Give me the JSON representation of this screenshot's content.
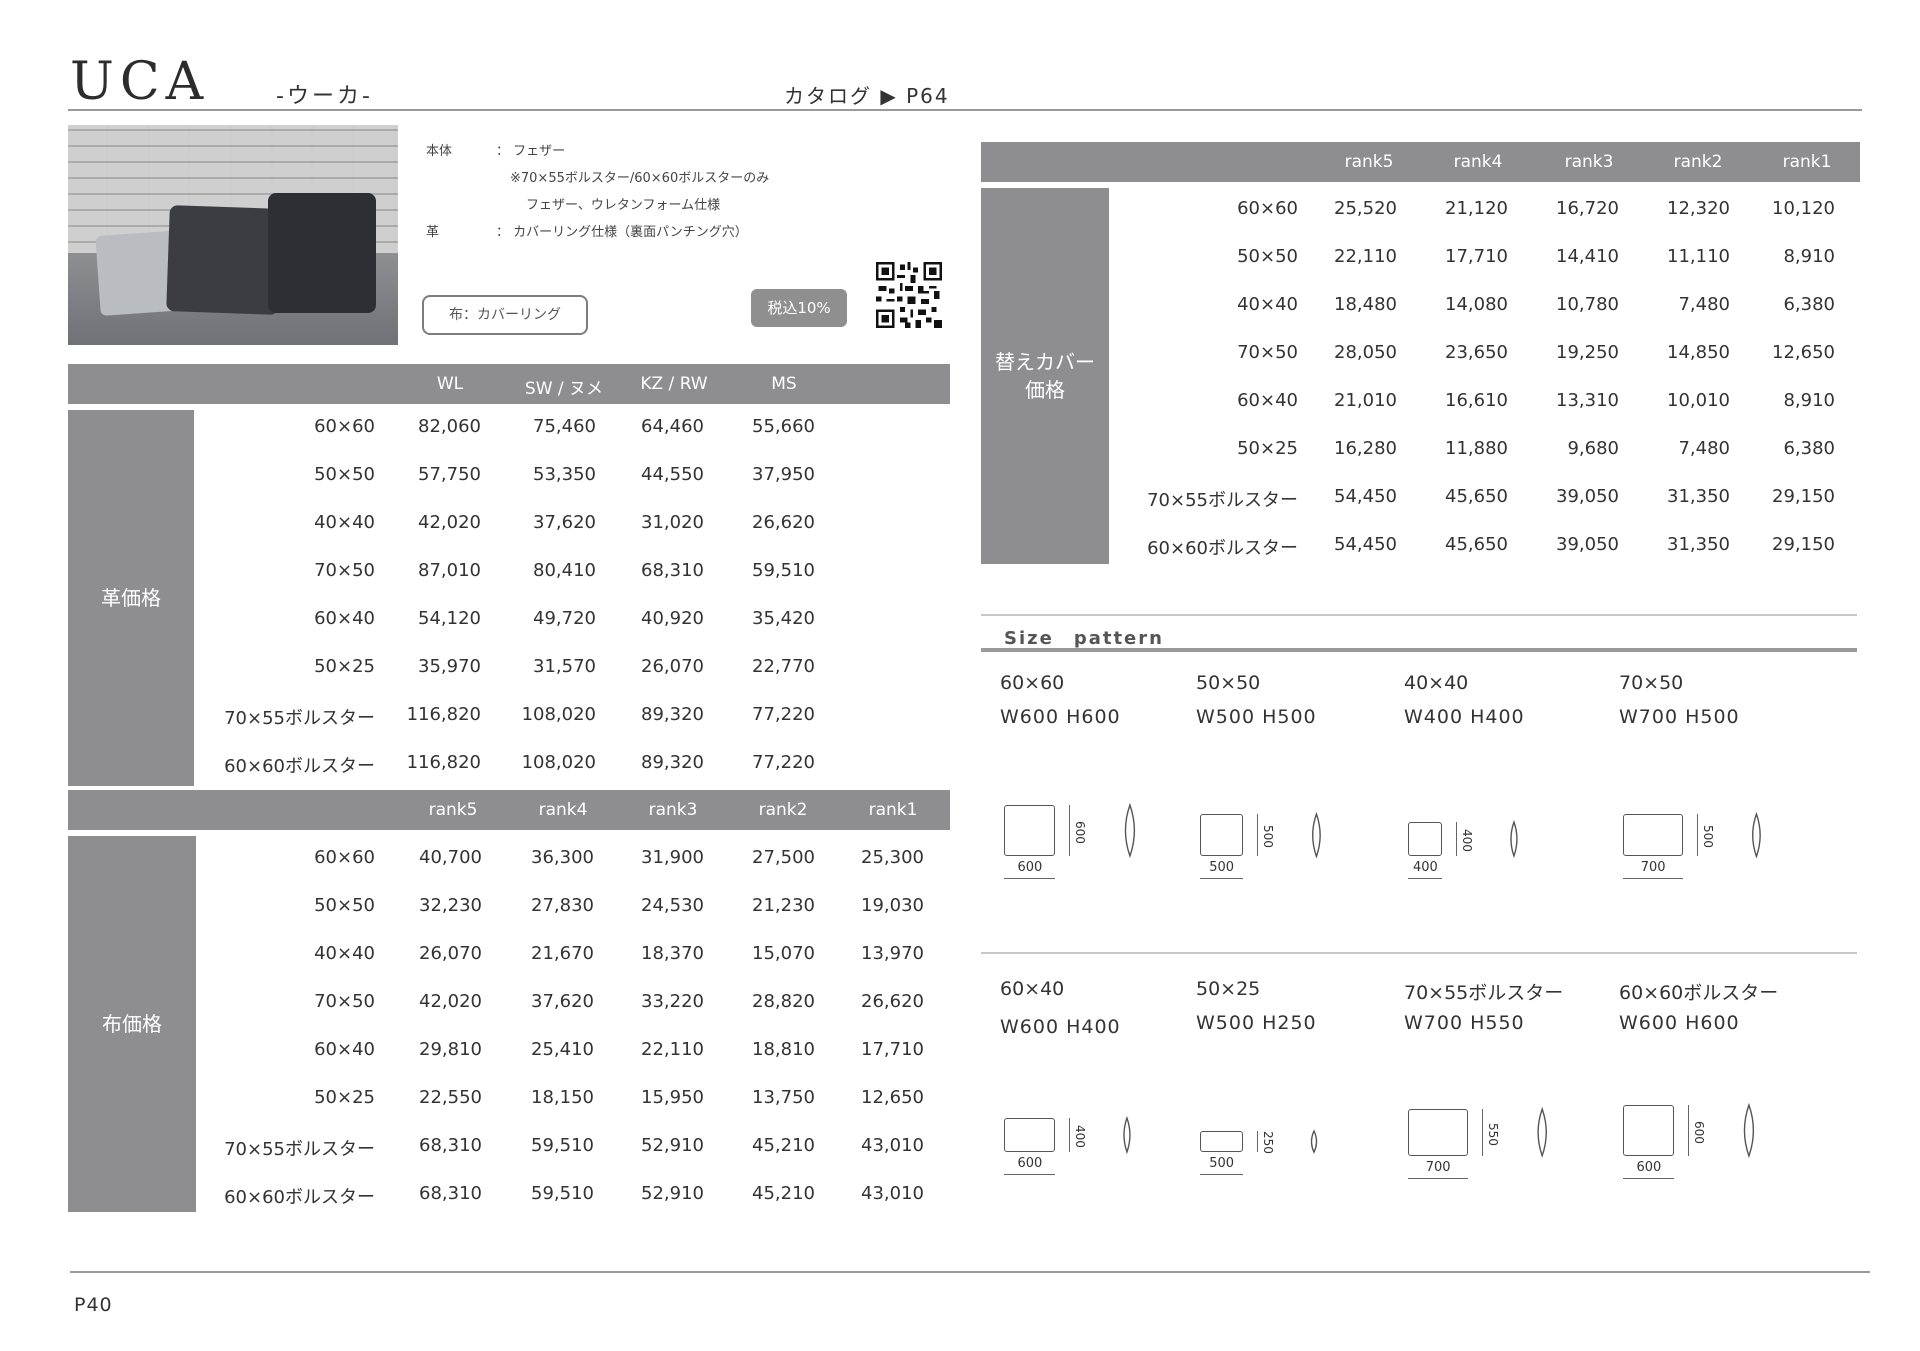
{
  "header": {
    "brand": "UCA",
    "kana": "-ウーカ-",
    "catalog_ref": "カタログ ▶ P64"
  },
  "spec": {
    "body_label": "本体",
    "body_value": "： フェザー",
    "body_note1": "※70×55ボルスター/60×60ボルスターのみ",
    "body_note2": "フェザー、ウレタンフォーム仕様",
    "leather_label": "革",
    "leather_value": "： カバーリング仕様（裏面パンチング穴）",
    "fabric_badge": "布：カバーリング",
    "tax_badge": "税込10%"
  },
  "leather_table": {
    "side_label": "革価格",
    "columns": [
      "WL",
      "SW / ヌメ",
      "KZ / RW",
      "MS"
    ],
    "rows": [
      {
        "size": "60×60",
        "values": [
          "82,060",
          "75,460",
          "64,460",
          "55,660"
        ]
      },
      {
        "size": "50×50",
        "values": [
          "57,750",
          "53,350",
          "44,550",
          "37,950"
        ]
      },
      {
        "size": "40×40",
        "values": [
          "42,020",
          "37,620",
          "31,020",
          "26,620"
        ]
      },
      {
        "size": "70×50",
        "values": [
          "87,010",
          "80,410",
          "68,310",
          "59,510"
        ]
      },
      {
        "size": "60×40",
        "values": [
          "54,120",
          "49,720",
          "40,920",
          "35,420"
        ]
      },
      {
        "size": "50×25",
        "values": [
          "35,970",
          "31,570",
          "26,070",
          "22,770"
        ]
      },
      {
        "size": "70×55ボルスター",
        "values": [
          "116,820",
          "108,020",
          "89,320",
          "77,220"
        ]
      },
      {
        "size": "60×60ボルスター",
        "values": [
          "116,820",
          "108,020",
          "89,320",
          "77,220"
        ]
      }
    ]
  },
  "fabric_table": {
    "side_label": "布価格",
    "columns": [
      "rank5",
      "rank4",
      "rank3",
      "rank2",
      "rank1"
    ],
    "rows": [
      {
        "size": "60×60",
        "values": [
          "40,700",
          "36,300",
          "31,900",
          "27,500",
          "25,300"
        ]
      },
      {
        "size": "50×50",
        "values": [
          "32,230",
          "27,830",
          "24,530",
          "21,230",
          "19,030"
        ]
      },
      {
        "size": "40×40",
        "values": [
          "26,070",
          "21,670",
          "18,370",
          "15,070",
          "13,970"
        ]
      },
      {
        "size": "70×50",
        "values": [
          "42,020",
          "37,620",
          "33,220",
          "28,820",
          "26,620"
        ]
      },
      {
        "size": "60×40",
        "values": [
          "29,810",
          "25,410",
          "22,110",
          "18,810",
          "17,710"
        ]
      },
      {
        "size": "50×25",
        "values": [
          "22,550",
          "18,150",
          "15,950",
          "13,750",
          "12,650"
        ]
      },
      {
        "size": "70×55ボルスター",
        "values": [
          "68,310",
          "59,510",
          "52,910",
          "45,210",
          "43,010"
        ]
      },
      {
        "size": "60×60ボルスター",
        "values": [
          "68,310",
          "59,510",
          "52,910",
          "45,210",
          "43,010"
        ]
      }
    ]
  },
  "cover_table": {
    "side_label_1": "替えカバー",
    "side_label_2": "価格",
    "columns": [
      "rank5",
      "rank4",
      "rank3",
      "rank2",
      "rank1"
    ],
    "rows": [
      {
        "size": "60×60",
        "values": [
          "25,520",
          "21,120",
          "16,720",
          "12,320",
          "10,120"
        ]
      },
      {
        "size": "50×50",
        "values": [
          "22,110",
          "17,710",
          "14,410",
          "11,110",
          "8,910"
        ]
      },
      {
        "size": "40×40",
        "values": [
          "18,480",
          "14,080",
          "10,780",
          "7,480",
          "6,380"
        ]
      },
      {
        "size": "70×50",
        "values": [
          "28,050",
          "23,650",
          "19,250",
          "14,850",
          "12,650"
        ]
      },
      {
        "size": "60×40",
        "values": [
          "21,010",
          "16,610",
          "13,310",
          "10,010",
          "8,910"
        ]
      },
      {
        "size": "50×25",
        "values": [
          "16,280",
          "11,880",
          "9,680",
          "7,480",
          "6,380"
        ]
      },
      {
        "size": "70×55ボルスター",
        "values": [
          "54,450",
          "45,650",
          "39,050",
          "31,350",
          "29,150"
        ]
      },
      {
        "size": "60×60ボルスター",
        "values": [
          "54,450",
          "45,650",
          "39,050",
          "31,350",
          "29,150"
        ]
      }
    ]
  },
  "size_pattern": {
    "title": "Size　pattern",
    "items": [
      {
        "name": "60×60",
        "dims": "W600  H600",
        "w": "600",
        "h": "600"
      },
      {
        "name": "50×50",
        "dims": "W500  H500",
        "w": "500",
        "h": "500"
      },
      {
        "name": "40×40",
        "dims": "W400  H400",
        "w": "400",
        "h": "400"
      },
      {
        "name": "70×50",
        "dims": "W700  H500",
        "w": "700",
        "h": "500"
      },
      {
        "name": "60×40",
        "dims": "W600  H400",
        "w": "600",
        "h": "400"
      },
      {
        "name": "50×25",
        "dims": "W500  H250",
        "w": "500",
        "h": "250"
      },
      {
        "name": "70×55ボルスター",
        "dims": "W700  H550",
        "w": "700",
        "h": "550"
      },
      {
        "name": "60×60ボルスター",
        "dims": "W600  H600",
        "w": "600",
        "h": "600"
      }
    ]
  },
  "footer": {
    "page": "P40"
  }
}
